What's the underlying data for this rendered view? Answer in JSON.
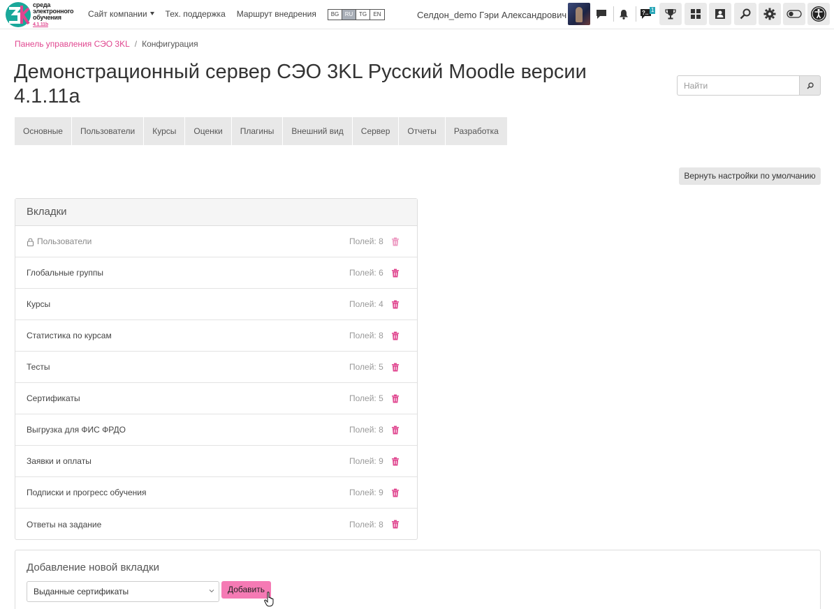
{
  "logo": {
    "mark": "3k",
    "line1": "среда",
    "line2": "электронного",
    "line3": "обучения",
    "version": "4.1.11b"
  },
  "nav": {
    "company_label": "Сайт компании",
    "support_label": "Тех. поддержка",
    "route_label": "Маршрут внедрения",
    "languages": [
      "BG",
      "RU",
      "TG",
      "EN"
    ],
    "active_language": "RU",
    "user_name": "Селдон_demo Гэри Александрович",
    "messages_badge": "1",
    "help_icon_text": "?.."
  },
  "breadcrumb": {
    "root": "Панель управления СЭО 3KL",
    "separator": "/",
    "current": "Конфигурация"
  },
  "page": {
    "title": "Демонстрационный сервер СЭО 3KL Русский Moodle версии 4.1.11а"
  },
  "search": {
    "placeholder": "Найти"
  },
  "tabs": [
    "Основные",
    "Пользователи",
    "Курсы",
    "Оценки",
    "Плагины",
    "Внешний вид",
    "Сервер",
    "Отчеты",
    "Разработка"
  ],
  "reset_button": "Вернуть настройки по умолчанию",
  "panel": {
    "title": "Вкладки",
    "rows": [
      {
        "name": "Пользователи",
        "count": "Полей: 8",
        "locked": true
      },
      {
        "name": "Глобальные группы",
        "count": "Полей: 6",
        "locked": false
      },
      {
        "name": "Курсы",
        "count": "Полей: 4",
        "locked": false
      },
      {
        "name": "Статистика по курсам",
        "count": "Полей: 8",
        "locked": false
      },
      {
        "name": "Тесты",
        "count": "Полей: 5",
        "locked": false
      },
      {
        "name": "Сертификаты",
        "count": "Полей: 5",
        "locked": false
      },
      {
        "name": "Выгрузка для ФИС ФРДО",
        "count": "Полей: 8",
        "locked": false
      },
      {
        "name": "Заявки и оплаты",
        "count": "Полей: 9",
        "locked": false
      },
      {
        "name": "Подписки и прогресс обучения",
        "count": "Полей: 9",
        "locked": false
      },
      {
        "name": "Ответы на задание",
        "count": "Полей: 8",
        "locked": false
      }
    ]
  },
  "add_panel": {
    "title": "Добавление новой вкладки",
    "selected_option": "Выданные сертификаты",
    "add_button": "Добавить"
  },
  "colors": {
    "accent": "#e0468f",
    "add_button": "#f57ab4",
    "tab_bg": "#e8e8e8",
    "badge": "#2aa7b8"
  }
}
